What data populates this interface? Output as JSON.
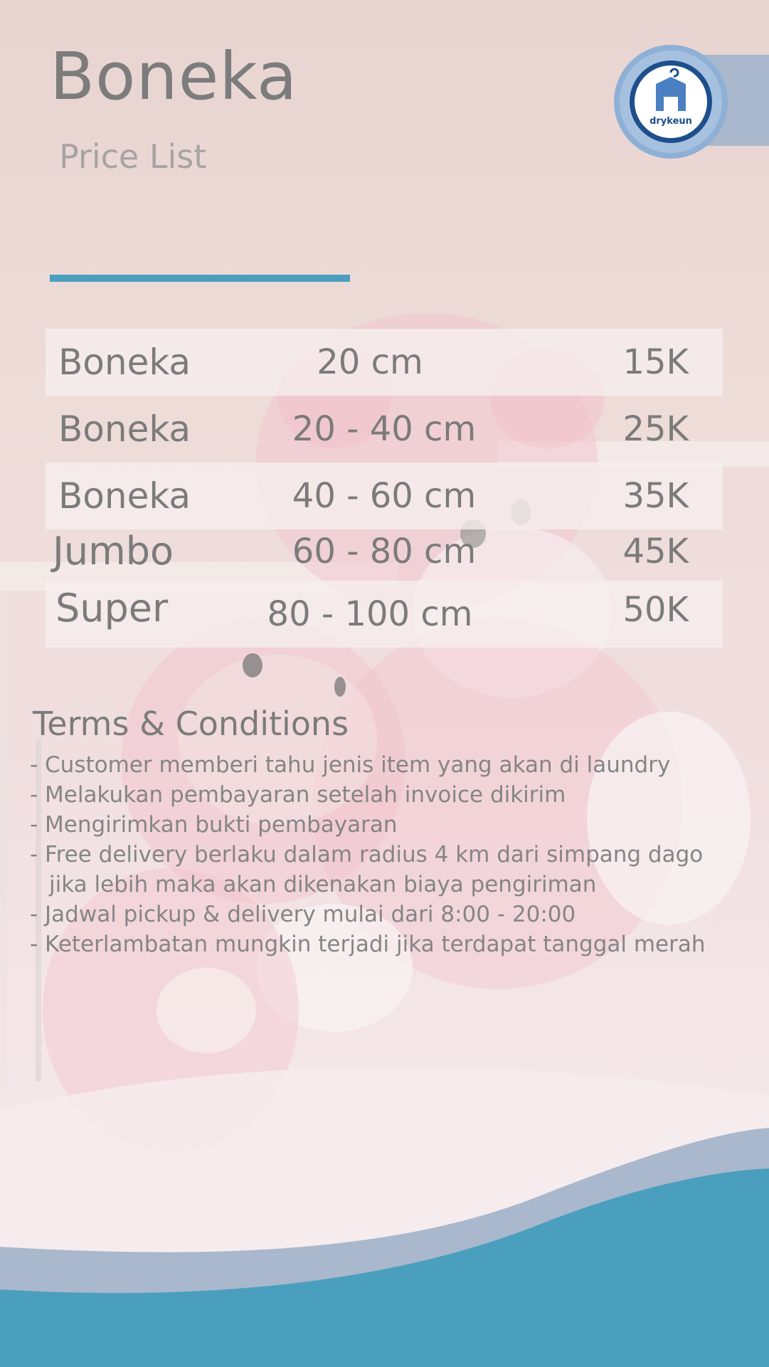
{
  "header": {
    "title": "Boneka",
    "subtitle": "Price List"
  },
  "logo": {
    "icon": "hanger-shirt-icon",
    "text": "drykeun"
  },
  "price_rows": [
    {
      "name": "Boneka",
      "size": "20 cm",
      "price": "15K"
    },
    {
      "name": "Boneka",
      "size": "20 - 40 cm",
      "price": "25K"
    },
    {
      "name": "Boneka",
      "size": "40 - 60 cm",
      "price": "35K"
    },
    {
      "name": "Jumbo",
      "size": "60 - 80 cm",
      "price": "45K"
    },
    {
      "name": "Super",
      "size": "80 - 100 cm",
      "price": "50K"
    }
  ],
  "terms": {
    "title": "Terms & Conditions",
    "items": [
      "- Customer memberi tahu jenis item yang akan di laundry",
      "- Melakukan pembayaran setelah invoice dikirim",
      "- Mengirimkan bukti pembayaran",
      "- Free delivery berlaku dalam radius 4 km dari simpang dago",
      "jika lebih maka akan dikenakan biaya pengiriman",
      "- Jadwal pickup & delivery mulai dari 8:00 - 20:00",
      "- Keterlambatan mungkin terjadi jika terdapat tanggal merah"
    ]
  },
  "colors": {
    "accent": "#4a9fbe",
    "wave_light": "#a9b8cc",
    "wave_dark": "#4a9fbe",
    "logo_ring": "#8fb0d6",
    "logo_navy": "#1d4f8c"
  }
}
